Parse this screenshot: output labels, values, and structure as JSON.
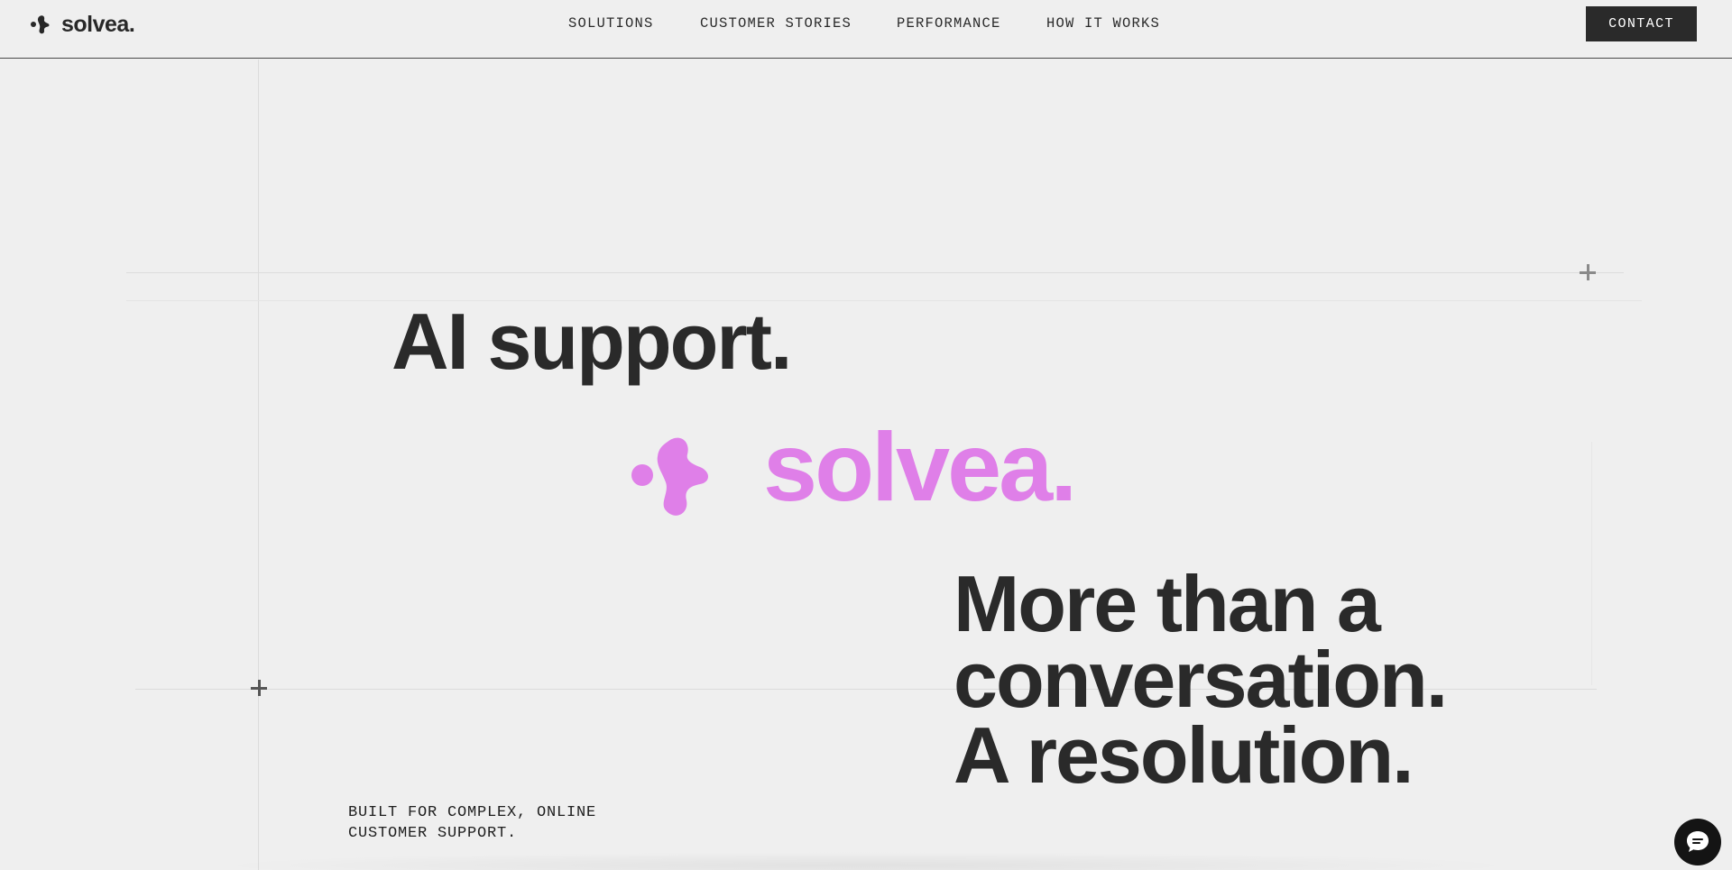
{
  "brand": {
    "name": "solvea.",
    "accent_color": "#df7fe8",
    "ink_color": "#282828"
  },
  "nav": {
    "items": [
      {
        "label": "SOLUTIONS"
      },
      {
        "label": "CUSTOMER STORIES"
      },
      {
        "label": "PERFORMANCE"
      },
      {
        "label": "HOW IT WORKS"
      }
    ],
    "contact_label": "CONTACT"
  },
  "hero": {
    "headline_top": "AI support.",
    "logo_text": "solvea.",
    "headline_lines": [
      "More than a",
      "conversation.",
      "A resolution."
    ],
    "tagline_lines": [
      "BUILT FOR COMPLEX, ONLINE",
      "CUSTOMER SUPPORT."
    ]
  },
  "widgets": {
    "chat_icon": "chat-bubble-icon",
    "plus_icon": "plus-icon"
  }
}
